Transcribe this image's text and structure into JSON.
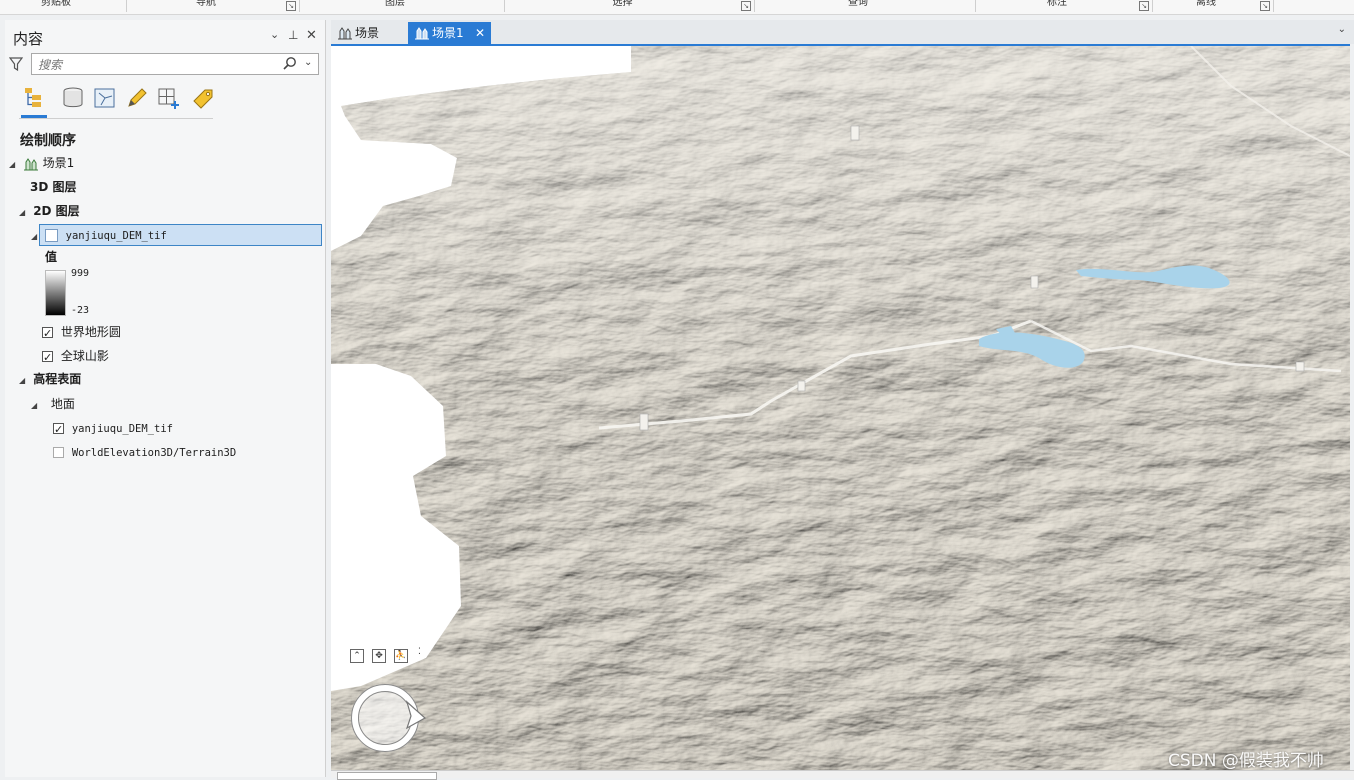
{
  "ribbon": {
    "groups": [
      "剪贴板",
      "导航",
      "图层",
      "选择",
      "查询",
      "标注",
      "离线"
    ]
  },
  "contents": {
    "title": "内容",
    "search_placeholder": "搜索",
    "tab_icons": [
      "list-by-drawing-order-icon",
      "list-by-data-source-icon",
      "list-by-selection-icon",
      "list-by-editing-icon",
      "list-by-snapping-icon",
      "list-by-labeling-icon"
    ],
    "heading": "绘制顺序",
    "scene": "场景1",
    "layers_3d": "3D 图层",
    "layers_2d": "2D 图层",
    "dem_layer": "yanjiuqu_DEM_tif",
    "legend": {
      "title": "值",
      "high": "999",
      "low": "-23"
    },
    "world_topo": "世界地形圆",
    "hillshade": "全球山影",
    "elevation_surfaces": "高程表面",
    "ground": "地面",
    "ground_sources": [
      {
        "label": "yanjiuqu_DEM_tif",
        "checked": true
      },
      {
        "label": "WorldElevation3D/Terrain3D",
        "checked": false
      }
    ]
  },
  "view": {
    "tabs": [
      {
        "label": "场景",
        "active": false
      },
      {
        "label": "场景1",
        "active": true
      }
    ],
    "colors": {
      "terrain": "#cfc9bc",
      "water": "#a9d3ea",
      "accent": "#2a7bd4"
    }
  },
  "watermark": "CSDN @假装我不帅"
}
